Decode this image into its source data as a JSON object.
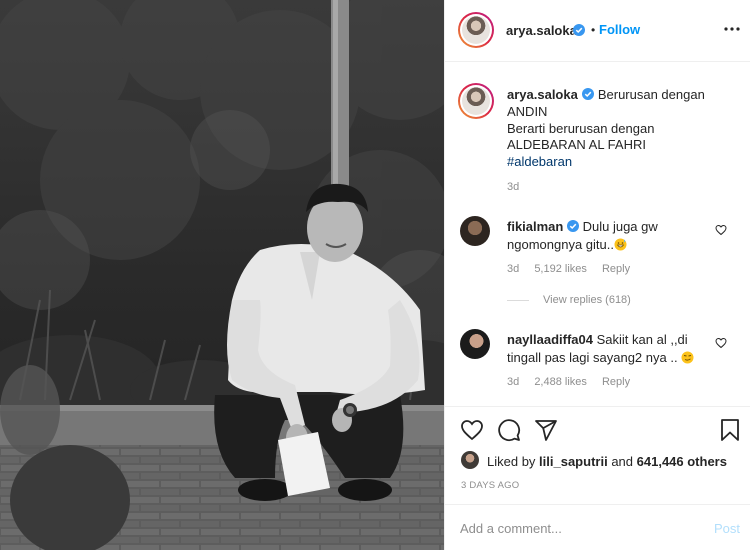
{
  "post": {
    "image_alt": "Black and white photo of a man in a white shirt crouching on a paved path",
    "author": "arya.saloka",
    "follow_label": "Follow",
    "separator": "•",
    "caption_lines": [
      "Berurusan dengan",
      "ANDIN",
      "Berarti berurusan dengan",
      "ALDEBARAN AL FAHRI"
    ],
    "hashtag": "#aldebaran",
    "caption_time": "3d"
  },
  "comments": [
    {
      "user": "fikialman",
      "verified": true,
      "text_line1": "Dulu juga gw",
      "text_line2": "ngomongnya gitu..",
      "emoji": "grinning-sweat-face",
      "time": "3d",
      "likes": "5,192 likes",
      "reply_label": "Reply",
      "view_replies": "View replies (618)"
    },
    {
      "user": "nayllaadiffa04",
      "verified": false,
      "text_line1": "Sakiit kan al ,,di",
      "text_line2": "tingall pas lagi sayang2 nya ..",
      "emoji": "smirking-face",
      "time": "3d",
      "likes": "2,488 likes",
      "reply_label": "Reply"
    }
  ],
  "liked_by": {
    "prefix": "Liked by",
    "user": "lili_saputrii",
    "connector": "and",
    "others": "641,446 others"
  },
  "posted_ago": "3 DAYS AGO",
  "add_comment": {
    "placeholder": "Add a comment...",
    "post_label": "Post"
  },
  "colors": {
    "accent": "#0095f6",
    "verified": "#3897f0",
    "hashtag": "#00376b",
    "muted": "#8e8e8e",
    "post_disabled": "#b2dffc"
  },
  "icons": [
    "more-options-icon",
    "heart-icon",
    "comment-icon",
    "share-icon",
    "bookmark-icon",
    "verified-badge-icon"
  ]
}
